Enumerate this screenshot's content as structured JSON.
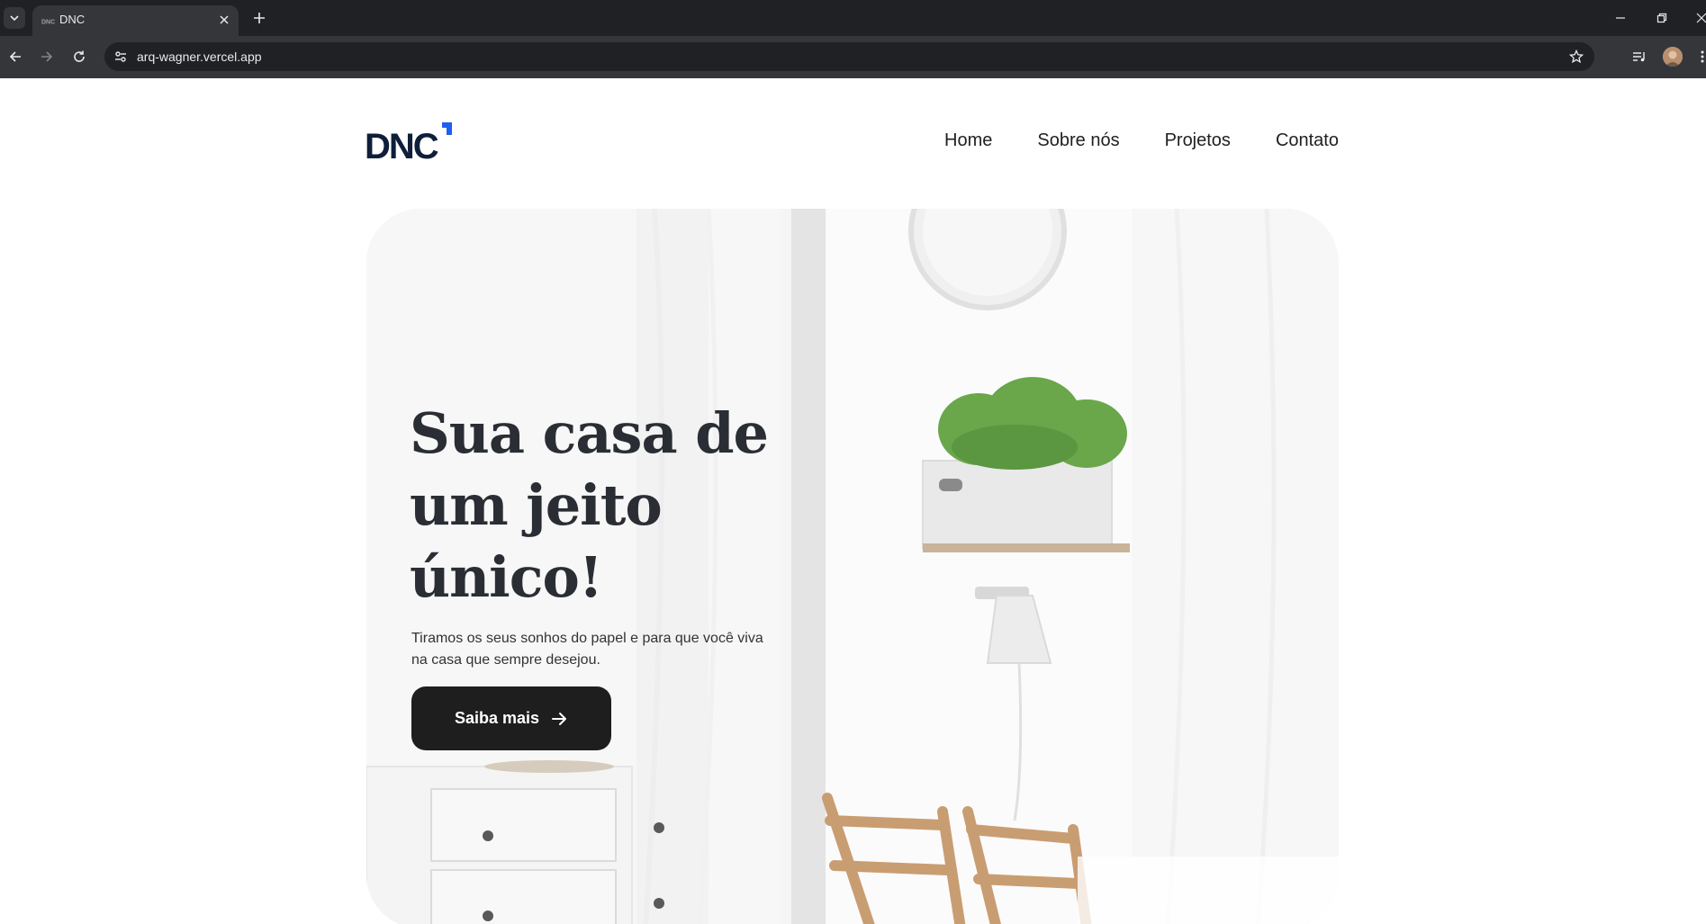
{
  "browser": {
    "tab_title": "DNC",
    "url": "arq-wagner.vercel.app"
  },
  "site": {
    "logo_text": "DNC",
    "accent_color": "#1f5ef2",
    "nav": [
      {
        "label": "Home"
      },
      {
        "label": "Sobre nós"
      },
      {
        "label": "Projetos"
      },
      {
        "label": "Contato"
      }
    ]
  },
  "hero": {
    "title_line1": "Sua casa de",
    "title_line2": "um jeito",
    "title_line3": "único!",
    "description": "Tiramos os seus sonhos do papel e para que você viva na casa que sempre desejou.",
    "button_label": "Saiba mais",
    "button_icon": "arrow-right-icon"
  }
}
